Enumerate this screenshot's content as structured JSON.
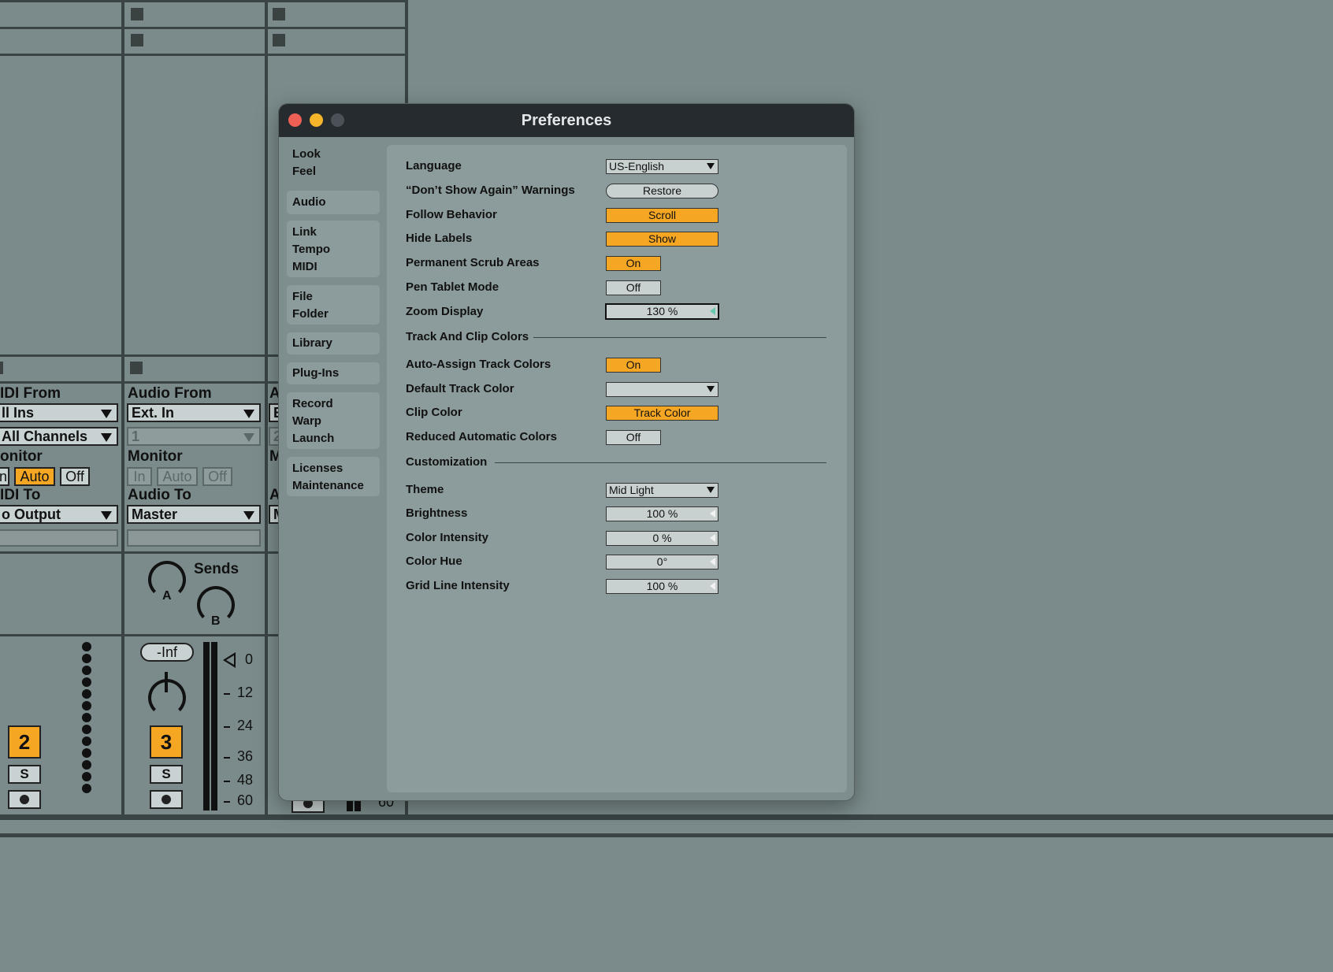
{
  "window": {
    "title": "Preferences",
    "traffic_lights": [
      "#ee5f56",
      "#f5b52a",
      "#4b5157"
    ]
  },
  "sidebar": {
    "groups": [
      [
        "Look",
        "Feel"
      ],
      [
        "Audio"
      ],
      [
        "Link",
        "Tempo",
        "MIDI"
      ],
      [
        "File",
        "Folder"
      ],
      [
        "Library"
      ],
      [
        "Plug-Ins"
      ],
      [
        "Record",
        "Warp",
        "Launch"
      ],
      [
        "Licenses",
        "Maintenance"
      ]
    ]
  },
  "settings": {
    "language": {
      "label": "Language",
      "value": "US-English"
    },
    "dont_show": {
      "label": "“Don’t Show Again” Warnings",
      "value": "Restore"
    },
    "follow": {
      "label": "Follow Behavior",
      "value": "Scroll"
    },
    "hide_labels": {
      "label": "Hide Labels",
      "value": "Show"
    },
    "scrub": {
      "label": "Permanent Scrub Areas",
      "value": "On"
    },
    "pen": {
      "label": "Pen Tablet Mode",
      "value": "Off"
    },
    "zoom": {
      "label": "Zoom Display",
      "value": "130 %"
    },
    "section_track": "Track And Clip Colors",
    "auto_assign": {
      "label": "Auto-Assign Track Colors",
      "value": "On"
    },
    "default_track": {
      "label": "Default Track Color",
      "value": ""
    },
    "clip_color": {
      "label": "Clip Color",
      "value": "Track Color"
    },
    "reduced": {
      "label": "Reduced Automatic Colors",
      "value": "Off"
    },
    "section_custom": "Customization",
    "theme": {
      "label": "Theme",
      "value": "Mid Light"
    },
    "brightness": {
      "label": "Brightness",
      "value": "100 %"
    },
    "intensity": {
      "label": "Color Intensity",
      "value": "0 %"
    },
    "hue": {
      "label": "Color Hue",
      "value": "0°"
    },
    "grid": {
      "label": "Grid Line Intensity",
      "value": "100 %"
    }
  },
  "mixer": {
    "track1": {
      "from_label": "IDI From",
      "from_value": "ll Ins",
      "channel_value": "All Channels",
      "monitor_label": "onitor",
      "monitor": [
        "n",
        "Auto",
        "Off"
      ],
      "to_label": "IDI To",
      "to_value": "o Output",
      "number": "2",
      "solo": "S"
    },
    "track2": {
      "from_label": "Audio From",
      "from_value": "Ext. In",
      "channel_value": "1",
      "monitor_label": "Monitor",
      "monitor": [
        "In",
        "Auto",
        "Off"
      ],
      "to_label": "Audio To",
      "to_value": "Master",
      "sends_label": "Sends",
      "knob_a": "A",
      "knob_b": "B",
      "volume": "-Inf",
      "number": "3",
      "solo": "S",
      "scale": [
        "0",
        "12",
        "24",
        "36",
        "48",
        "60"
      ]
    },
    "track3": {
      "from_label": "A",
      "from_value": "E",
      "channel_value": "2",
      "monitor_label": "M",
      "to_label": "A",
      "to_value": "M"
    },
    "hidden_scale": "60"
  }
}
